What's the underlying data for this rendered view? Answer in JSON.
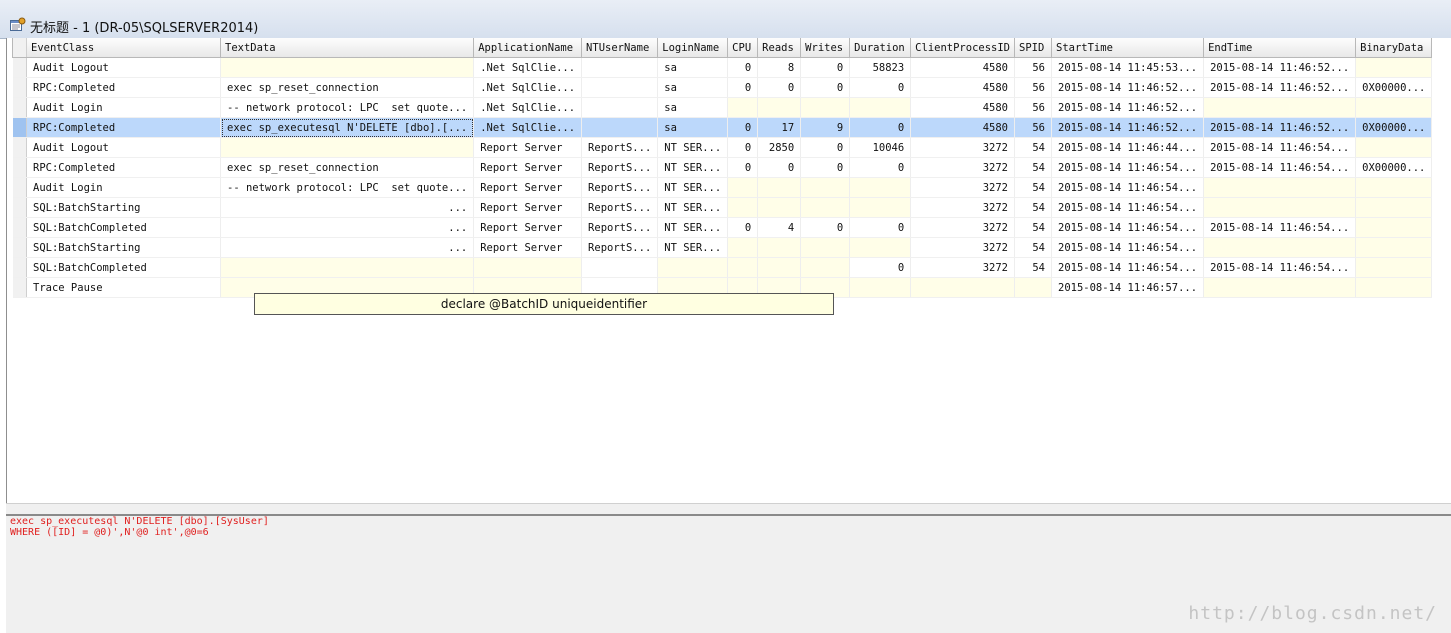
{
  "window": {
    "title": "无标题 - 1 (DR-05\\SQLSERVER2014)",
    "icon": "profiler-trace-icon"
  },
  "grid": {
    "columns": [
      "EventClass",
      "TextData",
      "ApplicationName",
      "NTUserName",
      "LoginName",
      "CPU",
      "Reads",
      "Writes",
      "Duration",
      "ClientProcessID",
      "SPID",
      "StartTime",
      "EndTime",
      "BinaryData"
    ],
    "rows": [
      {
        "selected": false,
        "cells": [
          "Audit Logout",
          "",
          ".Net SqlClie...",
          "",
          "sa",
          "0",
          "8",
          "0",
          "58823",
          "4580",
          "56",
          "2015-08-14 11:45:53...",
          "2015-08-14 11:46:52...",
          ""
        ]
      },
      {
        "selected": false,
        "cells": [
          "RPC:Completed",
          "exec sp_reset_connection",
          ".Net SqlClie...",
          "",
          "sa",
          "0",
          "0",
          "0",
          "0",
          "4580",
          "56",
          "2015-08-14 11:46:52...",
          "2015-08-14 11:46:52...",
          "0X00000..."
        ]
      },
      {
        "selected": false,
        "cells": [
          "Audit Login",
          "-- network protocol: LPC  set quote...",
          ".Net SqlClie...",
          "",
          "sa",
          "",
          "",
          "",
          "",
          "4580",
          "56",
          "2015-08-14 11:46:52...",
          "",
          ""
        ]
      },
      {
        "selected": true,
        "cells": [
          "RPC:Completed",
          "exec sp_executesql N'DELETE [dbo].[...",
          ".Net SqlClie...",
          "",
          "sa",
          "0",
          "17",
          "9",
          "0",
          "4580",
          "56",
          "2015-08-14 11:46:52...",
          "2015-08-14 11:46:52...",
          "0X00000..."
        ]
      },
      {
        "selected": false,
        "cells": [
          "Audit Logout",
          "",
          "Report Server",
          "ReportS...",
          "NT SER...",
          "0",
          "2850",
          "0",
          "10046",
          "3272",
          "54",
          "2015-08-14 11:46:44...",
          "2015-08-14 11:46:54...",
          ""
        ]
      },
      {
        "selected": false,
        "cells": [
          "RPC:Completed",
          "exec sp_reset_connection",
          "Report Server",
          "ReportS...",
          "NT SER...",
          "0",
          "0",
          "0",
          "0",
          "3272",
          "54",
          "2015-08-14 11:46:54...",
          "2015-08-14 11:46:54...",
          "0X00000..."
        ]
      },
      {
        "selected": false,
        "cells": [
          "Audit Login",
          "-- network protocol: LPC  set quote...",
          "Report Server",
          "ReportS...",
          "NT SER...",
          "",
          "",
          "",
          "",
          "3272",
          "54",
          "2015-08-14 11:46:54...",
          "",
          ""
        ]
      },
      {
        "selected": false,
        "cells": [
          "SQL:BatchStarting",
          "...",
          "Report Server",
          "ReportS...",
          "NT SER...",
          "",
          "",
          "",
          "",
          "3272",
          "54",
          "2015-08-14 11:46:54...",
          "",
          ""
        ]
      },
      {
        "selected": false,
        "cells": [
          "SQL:BatchCompleted",
          "...",
          "Report Server",
          "ReportS...",
          "NT SER...",
          "0",
          "4",
          "0",
          "0",
          "3272",
          "54",
          "2015-08-14 11:46:54...",
          "2015-08-14 11:46:54...",
          ""
        ]
      },
      {
        "selected": false,
        "cells": [
          "SQL:BatchStarting",
          "...",
          "Report Server",
          "ReportS...",
          "NT SER...",
          "",
          "",
          "",
          "",
          "3272",
          "54",
          "2015-08-14 11:46:54...",
          "",
          ""
        ]
      },
      {
        "selected": false,
        "cells": [
          "SQL:BatchCompleted",
          "",
          "",
          "",
          "",
          "",
          "",
          "",
          "0",
          "3272",
          "54",
          "2015-08-14 11:46:54...",
          "2015-08-14 11:46:54...",
          ""
        ]
      },
      {
        "selected": false,
        "cells": [
          "Trace Pause",
          "",
          "",
          "",
          "",
          "",
          "",
          "",
          "",
          "",
          "",
          "2015-08-14 11:46:57...",
          "",
          ""
        ]
      }
    ]
  },
  "tooltip": {
    "text": "declare @BatchID uniqueidentifier"
  },
  "detail": {
    "lines": [
      "exec sp_executesql N'DELETE [dbo].[SysUser]",
      "WHERE ([ID] = @0)',N'@0 int',@0=6"
    ],
    "text_color": "#e0201f"
  },
  "watermark": "http://blog.csdn.net/",
  "colors": {
    "selection": "#bcd8fb",
    "empty_cell": "#fffee8",
    "title_bar": "#d6e0ee"
  }
}
